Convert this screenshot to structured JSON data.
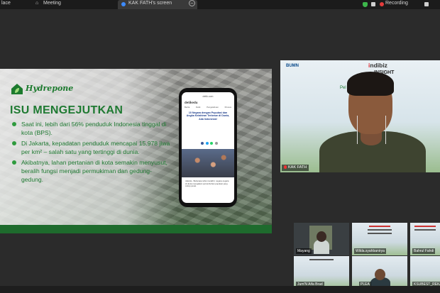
{
  "topbar": {
    "app_label": "lace",
    "meeting_label": "Meeting",
    "share_tab_label": "KAK FATH's screen",
    "recording_label": "Recording",
    "close_glyph": "–"
  },
  "slide": {
    "logo_text": "Hydrepone",
    "title": "ISU MENGEJUTKAN",
    "bullets": [
      "Saat ini, lebih dari 56% penduduk Indonesia tinggal di kota (BPS).",
      "Di Jakarta, kepadatan penduduk mencapai 15.978 jiwa per km² – salah satu yang tertinggi di dunia.",
      "Akibatnya, lahan pertanian di kota semakin menyusut, beralih fungsi menjadi permukiman dan gedung-gedung."
    ],
    "phone": {
      "url": "detik.com",
      "site": "detikedu",
      "nav": [
        "Berita",
        "Detik",
        "Pengetahuan",
        "Khusus"
      ],
      "headline": "10 Negara dengan Populasi dan Angka Kelahiran Terbesar di Dunia, Ada Indonesia!",
      "body": "Jakarta - Beberapa tahun terakhir, negara-negara di dunia mengalami pertumbuhan populasi yang cukup pesat."
    }
  },
  "speaker": {
    "bumn_label": "BUMN",
    "brand": "indibiz",
    "insight": "INSIGHT",
    "sub": "Pel           erkelanjutan",
    "name": "KAK FATH"
  },
  "gallery": [
    {
      "name": "Mayang",
      "style": "dark"
    },
    {
      "name": "Wilda.syahbanirya",
      "style": "light"
    },
    {
      "name": "Bahrul Fahdi",
      "style": "light"
    },
    {
      "name": "Jum'N Aifa Brad",
      "style": "light"
    },
    {
      "name": "PLEA",
      "style": "light"
    },
    {
      "name": "KSUBEST_REKARA",
      "style": "light"
    }
  ],
  "colors": {
    "slide_green": "#1f7a32",
    "recording_red": "#e33b3b",
    "shield_green": "#3cb54a"
  }
}
